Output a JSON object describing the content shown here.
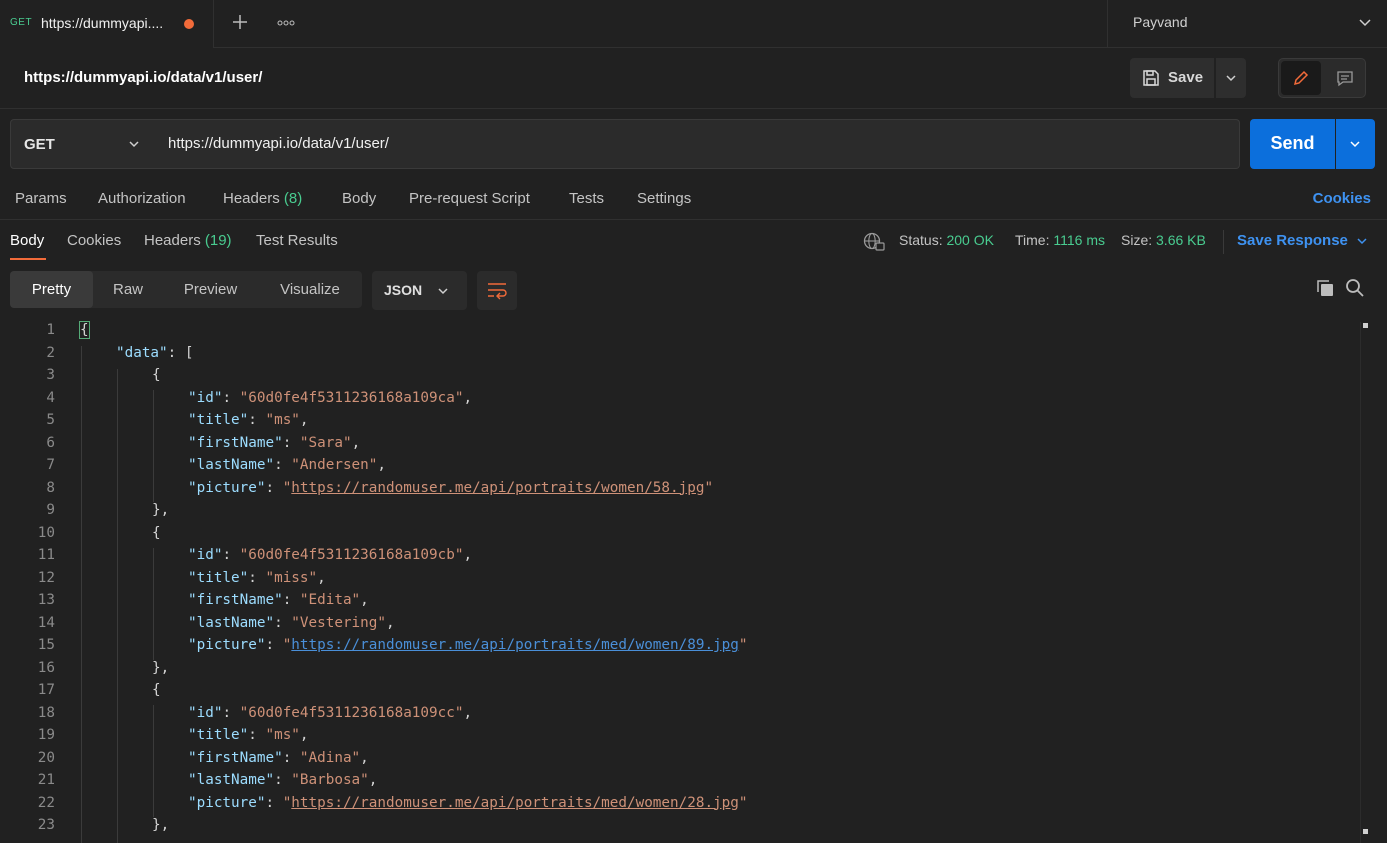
{
  "tab": {
    "method": "GET",
    "title": "https://dummyapi...."
  },
  "workspace": {
    "name": "Payvand"
  },
  "request": {
    "title": "https://dummyapi.io/data/v1/user/",
    "method": "GET",
    "url": "https://dummyapi.io/data/v1/user/",
    "save_label": "Save",
    "send_label": "Send"
  },
  "request_tabs": {
    "params": "Params",
    "authorization": "Authorization",
    "headers": "Headers",
    "headers_count": "(8)",
    "body": "Body",
    "prerequest": "Pre-request Script",
    "tests": "Tests",
    "settings": "Settings",
    "cookies": "Cookies"
  },
  "response_tabs": {
    "body": "Body",
    "cookies": "Cookies",
    "headers": "Headers",
    "headers_count": "(19)",
    "test_results": "Test Results"
  },
  "response_meta": {
    "status_label": "Status:",
    "status_value": "200 OK",
    "time_label": "Time:",
    "time_value": "1116 ms",
    "size_label": "Size:",
    "size_value": "3.66 KB",
    "save_response": "Save Response"
  },
  "viewer": {
    "pretty": "Pretty",
    "raw": "Raw",
    "preview": "Preview",
    "visualize": "Visualize",
    "format": "JSON"
  },
  "code_lines": [
    {
      "n": "1",
      "indent": 0,
      "parts": [
        {
          "t": "p",
          "v": "{"
        }
      ]
    },
    {
      "n": "2",
      "indent": 1,
      "parts": [
        {
          "t": "k",
          "v": "\"data\""
        },
        {
          "t": "p",
          "v": ": ["
        }
      ]
    },
    {
      "n": "3",
      "indent": 2,
      "parts": [
        {
          "t": "p",
          "v": "{"
        }
      ]
    },
    {
      "n": "4",
      "indent": 3,
      "parts": [
        {
          "t": "k",
          "v": "\"id\""
        },
        {
          "t": "p",
          "v": ": "
        },
        {
          "t": "s",
          "v": "\"60d0fe4f5311236168a109ca\""
        },
        {
          "t": "p",
          "v": ","
        }
      ]
    },
    {
      "n": "5",
      "indent": 3,
      "parts": [
        {
          "t": "k",
          "v": "\"title\""
        },
        {
          "t": "p",
          "v": ": "
        },
        {
          "t": "s",
          "v": "\"ms\""
        },
        {
          "t": "p",
          "v": ","
        }
      ]
    },
    {
      "n": "6",
      "indent": 3,
      "parts": [
        {
          "t": "k",
          "v": "\"firstName\""
        },
        {
          "t": "p",
          "v": ": "
        },
        {
          "t": "s",
          "v": "\"Sara\""
        },
        {
          "t": "p",
          "v": ","
        }
      ]
    },
    {
      "n": "7",
      "indent": 3,
      "parts": [
        {
          "t": "k",
          "v": "\"lastName\""
        },
        {
          "t": "p",
          "v": ": "
        },
        {
          "t": "s",
          "v": "\"Andersen\""
        },
        {
          "t": "p",
          "v": ","
        }
      ]
    },
    {
      "n": "8",
      "indent": 3,
      "parts": [
        {
          "t": "k",
          "v": "\"picture\""
        },
        {
          "t": "p",
          "v": ": "
        },
        {
          "t": "s",
          "v": "\""
        },
        {
          "t": "u",
          "v": "https://randomuser.me/api/portraits/women/58.jpg"
        },
        {
          "t": "s",
          "v": "\""
        }
      ]
    },
    {
      "n": "9",
      "indent": 2,
      "parts": [
        {
          "t": "p",
          "v": "},"
        }
      ]
    },
    {
      "n": "10",
      "indent": 2,
      "parts": [
        {
          "t": "p",
          "v": "{"
        }
      ]
    },
    {
      "n": "11",
      "indent": 3,
      "parts": [
        {
          "t": "k",
          "v": "\"id\""
        },
        {
          "t": "p",
          "v": ": "
        },
        {
          "t": "s",
          "v": "\"60d0fe4f5311236168a109cb\""
        },
        {
          "t": "p",
          "v": ","
        }
      ]
    },
    {
      "n": "12",
      "indent": 3,
      "parts": [
        {
          "t": "k",
          "v": "\"title\""
        },
        {
          "t": "p",
          "v": ": "
        },
        {
          "t": "s",
          "v": "\"miss\""
        },
        {
          "t": "p",
          "v": ","
        }
      ]
    },
    {
      "n": "13",
      "indent": 3,
      "parts": [
        {
          "t": "k",
          "v": "\"firstName\""
        },
        {
          "t": "p",
          "v": ": "
        },
        {
          "t": "s",
          "v": "\"Edita\""
        },
        {
          "t": "p",
          "v": ","
        }
      ]
    },
    {
      "n": "14",
      "indent": 3,
      "parts": [
        {
          "t": "k",
          "v": "\"lastName\""
        },
        {
          "t": "p",
          "v": ": "
        },
        {
          "t": "s",
          "v": "\"Vestering\""
        },
        {
          "t": "p",
          "v": ","
        }
      ]
    },
    {
      "n": "15",
      "indent": 3,
      "parts": [
        {
          "t": "k",
          "v": "\"picture\""
        },
        {
          "t": "p",
          "v": ": "
        },
        {
          "t": "s",
          "v": "\""
        },
        {
          "t": "ub",
          "v": "https://randomuser.me/api/portraits/med/women/89.jpg"
        },
        {
          "t": "s",
          "v": "\""
        }
      ]
    },
    {
      "n": "16",
      "indent": 2,
      "parts": [
        {
          "t": "p",
          "v": "},"
        }
      ]
    },
    {
      "n": "17",
      "indent": 2,
      "parts": [
        {
          "t": "p",
          "v": "{"
        }
      ]
    },
    {
      "n": "18",
      "indent": 3,
      "parts": [
        {
          "t": "k",
          "v": "\"id\""
        },
        {
          "t": "p",
          "v": ": "
        },
        {
          "t": "s",
          "v": "\"60d0fe4f5311236168a109cc\""
        },
        {
          "t": "p",
          "v": ","
        }
      ]
    },
    {
      "n": "19",
      "indent": 3,
      "parts": [
        {
          "t": "k",
          "v": "\"title\""
        },
        {
          "t": "p",
          "v": ": "
        },
        {
          "t": "s",
          "v": "\"ms\""
        },
        {
          "t": "p",
          "v": ","
        }
      ]
    },
    {
      "n": "20",
      "indent": 3,
      "parts": [
        {
          "t": "k",
          "v": "\"firstName\""
        },
        {
          "t": "p",
          "v": ": "
        },
        {
          "t": "s",
          "v": "\"Adina\""
        },
        {
          "t": "p",
          "v": ","
        }
      ]
    },
    {
      "n": "21",
      "indent": 3,
      "parts": [
        {
          "t": "k",
          "v": "\"lastName\""
        },
        {
          "t": "p",
          "v": ": "
        },
        {
          "t": "s",
          "v": "\"Barbosa\""
        },
        {
          "t": "p",
          "v": ","
        }
      ]
    },
    {
      "n": "22",
      "indent": 3,
      "parts": [
        {
          "t": "k",
          "v": "\"picture\""
        },
        {
          "t": "p",
          "v": ": "
        },
        {
          "t": "s",
          "v": "\""
        },
        {
          "t": "u",
          "v": "https://randomuser.me/api/portraits/med/women/28.jpg"
        },
        {
          "t": "s",
          "v": "\""
        }
      ]
    },
    {
      "n": "23",
      "indent": 2,
      "parts": [
        {
          "t": "p",
          "v": "},"
        }
      ]
    }
  ],
  "colors": {
    "accent_orange": "#f26b3a",
    "send_blue": "#0c6fdc",
    "link_blue": "#3e92f1",
    "status_green": "#49cc90",
    "json_key": "#9cdcfe",
    "json_string": "#ce9178"
  },
  "icons": {
    "plus": "plus-icon",
    "more": "more-icon",
    "save": "save-icon",
    "edit": "pencil-icon",
    "comment": "comment-icon",
    "globe": "globe-icon",
    "wrap": "wrap-lines-icon",
    "copy": "copy-icon",
    "search": "search-icon"
  }
}
